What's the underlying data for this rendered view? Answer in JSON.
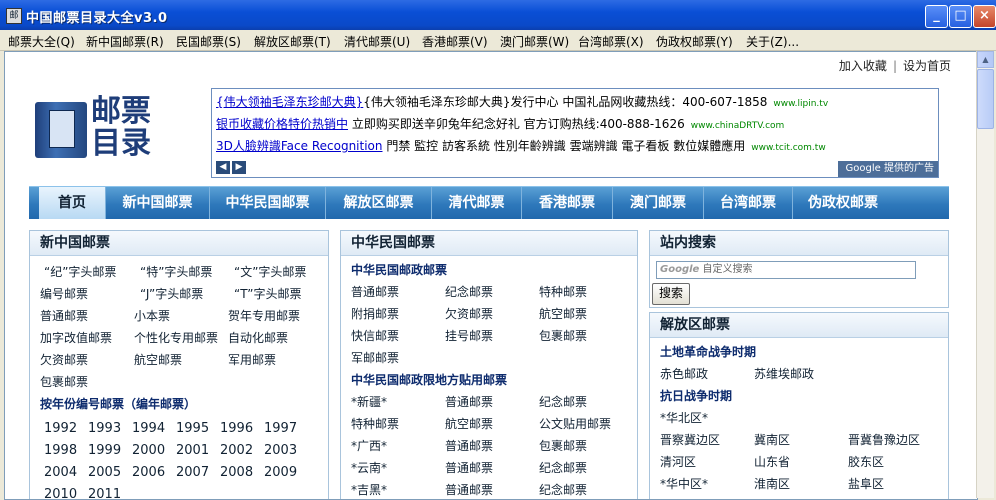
{
  "window": {
    "title": "中国邮票目录大全v3.0",
    "icon_label": "邮",
    "controls": {
      "minimize": "_",
      "maximize": "□",
      "close": "×"
    }
  },
  "menu": [
    "邮票大全(Q)",
    "新中国邮票(R)",
    "民国邮票(S)",
    "解放区邮票(T)",
    "清代邮票(U)",
    "香港邮票(V)",
    "澳门邮票(W)",
    "台湾邮票(X)",
    "伪政权邮票(Y)",
    "关于(Z)..."
  ],
  "top_links": {
    "favorite": "加入收藏",
    "sep": "|",
    "homepage": "设为首页"
  },
  "logo": {
    "line1": "邮票",
    "line2": "目录"
  },
  "ads": {
    "lines": [
      {
        "link": "{伟大领袖毛泽东珍邮大典}",
        "text": "{伟大领袖毛泽东珍邮大典}发行中心  中国礼品网收藏热线：400-607-1858",
        "url": "www.lipin.tv"
      },
      {
        "link": "银币收藏价格特价热销中",
        "text": "立即购买即送辛卯兔年纪念好礼  官方订购热线:400-888-1626",
        "url": "www.chinaDRTV.com"
      },
      {
        "link": "3D人臉辨識Face Recognition",
        "text": "門禁 監控 訪客系統 性別年齡辨識 雲端辨識 電子看板 數位媒體應用",
        "url": "www.tcit.com.tw"
      }
    ],
    "prev": "◀",
    "next": "▶",
    "brand": "Google 提供的广告"
  },
  "nav": [
    "首页",
    "新中国邮票",
    "中华民国邮票",
    "解放区邮票",
    "清代邮票",
    "香港邮票",
    "澳门邮票",
    "台湾邮票",
    "伪政权邮票"
  ],
  "new_china": {
    "title": "新中国邮票",
    "rows": [
      [
        "“纪”字头邮票",
        "“特”字头邮票",
        "“文”字头邮票"
      ],
      [
        "编号邮票",
        "“J”字头邮票",
        "“T”字头邮票"
      ],
      [
        "普通邮票",
        "小本票",
        "贺年专用邮票"
      ],
      [
        "加字改值邮票",
        "个性化专用邮票",
        "自动化邮票"
      ],
      [
        "欠资邮票",
        "航空邮票",
        "军用邮票"
      ],
      [
        "包裹邮票"
      ]
    ],
    "year_title": "按年份编号邮票（编年邮票）",
    "years": [
      [
        "1992",
        "1993",
        "1994",
        "1995",
        "1996",
        "1997"
      ],
      [
        "1998",
        "1999",
        "2000",
        "2001",
        "2002",
        "2003"
      ],
      [
        "2004",
        "2005",
        "2006",
        "2007",
        "2008",
        "2009"
      ],
      [
        "2010",
        "2011"
      ]
    ]
  },
  "roc": {
    "title": "中华民国邮票",
    "sub1": "中华民国邮政邮票",
    "rows1": [
      [
        "普通邮票",
        "纪念邮票",
        "特种邮票"
      ],
      [
        "附捐邮票",
        "欠资邮票",
        "航空邮票"
      ],
      [
        "快信邮票",
        "挂号邮票",
        "包裹邮票"
      ],
      [
        "军邮邮票"
      ]
    ],
    "sub2": "中华民国邮政限地方贴用邮票",
    "rows2": [
      [
        "*新疆*",
        "普通邮票",
        "纪念邮票"
      ],
      [
        "特种邮票",
        "航空邮票",
        "公文贴用邮票"
      ],
      [
        "*广西*",
        "普通邮票",
        "包裹邮票"
      ],
      [
        "*云南*",
        "普通邮票",
        "纪念邮票"
      ],
      [
        "*吉黑*",
        "普通邮票",
        "纪念邮票"
      ]
    ]
  },
  "search": {
    "title": "站内搜索",
    "placeholder_brand": "Google",
    "placeholder": "自定义搜索",
    "button": "搜索"
  },
  "liberated": {
    "title": "解放区邮票",
    "sub1": "土地革命战争时期",
    "rows1": [
      [
        "赤色邮政",
        "苏维埃邮政"
      ]
    ],
    "sub2": "抗日战争时期",
    "region": "*华北区*",
    "rows2": [
      [
        "晋察冀边区",
        "冀南区",
        "晋冀鲁豫边区"
      ],
      [
        "清河区",
        "山东省",
        "胶东区"
      ],
      [
        "*华中区*",
        "淮南区",
        "盐阜区"
      ]
    ]
  }
}
